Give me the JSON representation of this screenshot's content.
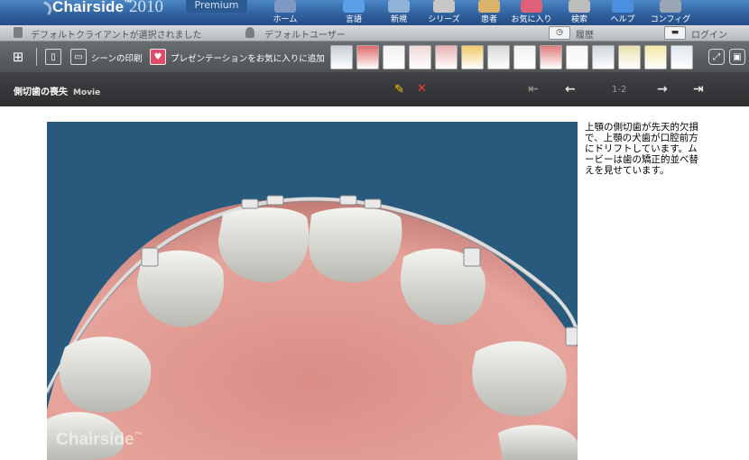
{
  "app": {
    "name": "Chairside",
    "year": "2010",
    "edition": "Premium",
    "watermark": "Chairside"
  },
  "topnav": [
    {
      "label": "ホーム",
      "icon": "home-icon",
      "color": "#7f98c4"
    },
    {
      "label": "言語",
      "icon": "language-icon",
      "color": "#5aa0e6"
    },
    {
      "label": "新規",
      "icon": "new-icon",
      "color": "#8fb3d8"
    },
    {
      "label": "シリーズ",
      "icon": "series-icon",
      "color": "#c7c7c7"
    },
    {
      "label": "患者",
      "icon": "patient-icon",
      "color": "#d9b36a"
    },
    {
      "label": "お気に入り",
      "icon": "favorites-icon",
      "color": "#e0607a"
    },
    {
      "label": "検索",
      "icon": "search-icon",
      "color": "#bdbdbd"
    },
    {
      "label": "ヘルプ",
      "icon": "help-icon",
      "color": "#4a8fe0"
    },
    {
      "label": "コンフィグ",
      "icon": "config-icon",
      "color": "#9aa6b5"
    }
  ],
  "status": {
    "client": "デフォルトクライアントが選択されました",
    "user": "デフォルトユーザー",
    "history": "履歴",
    "login": "ログイン"
  },
  "toolbar": {
    "print_scene": "シーンの印刷",
    "add_favorite": "プレゼンテーションをお気に入りに追加",
    "thumbnail_colors": [
      "#c9cfd6",
      "#e06a6a",
      "#f1f1f1",
      "#f1d7d7",
      "#e9b3b3",
      "#f3c96a",
      "#d8d8d8",
      "#f1f1f1",
      "#e07c7c",
      "#f6f6f6",
      "#cfd6dc",
      "#e9e1b0",
      "#f3e9a3",
      "#dfe6ee"
    ]
  },
  "scene": {
    "title": "側切歯の喪失",
    "type": "Movie",
    "page": "1-2",
    "description": "上顎の側切歯が先天的欠損で、上顎の犬歯が口腔前方にドリフトしています。ムービーは歯の矯正的並べ替えを見せています。"
  }
}
